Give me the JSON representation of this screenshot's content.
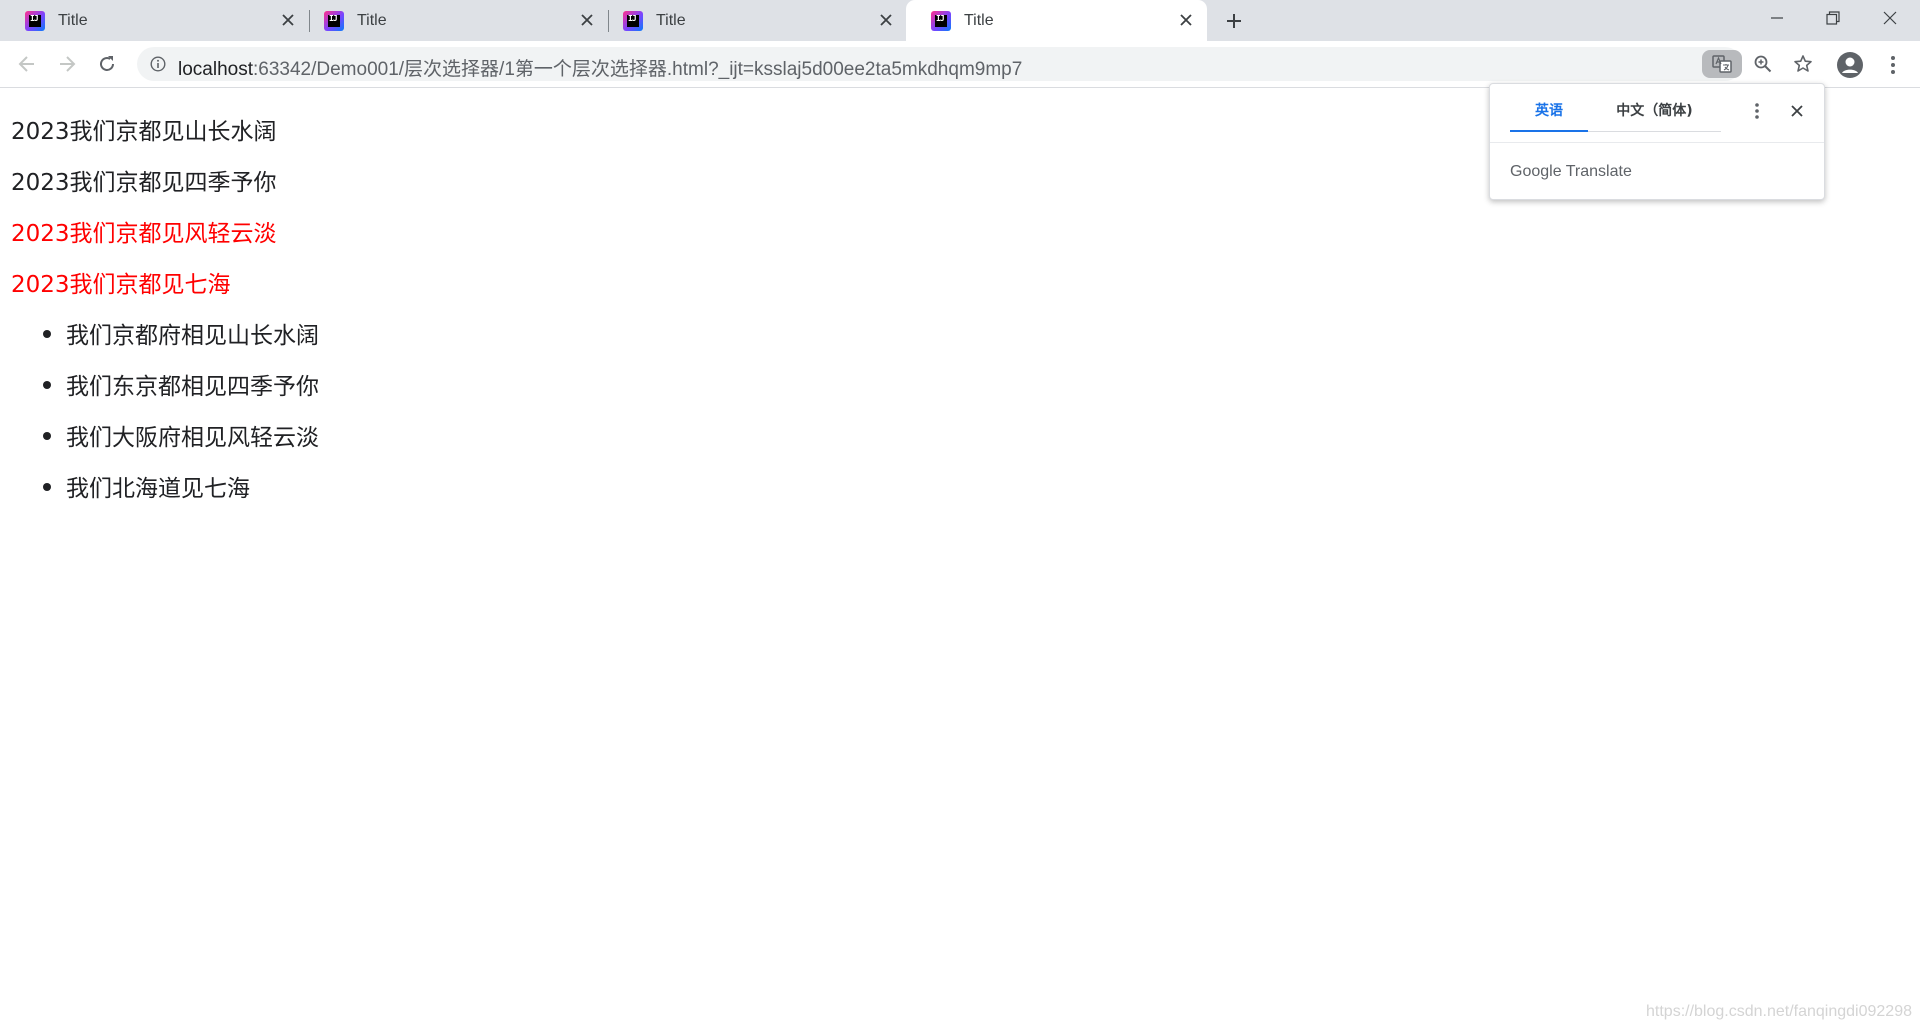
{
  "tabs": [
    {
      "title": "Title",
      "active": false
    },
    {
      "title": "Title",
      "active": false
    },
    {
      "title": "Title",
      "active": false
    },
    {
      "title": "Title",
      "active": true
    }
  ],
  "address_bar": {
    "host": "localhost",
    "path": ":63342/Demo001/层次选择器/1第一个层次选择器.html?_ijt=ksslaj5d00ee2ta5mkdhqm9mp7"
  },
  "page": {
    "paragraphs": [
      {
        "text": "2023我们京都见山长水阔",
        "color": "#202124"
      },
      {
        "text": "2023我们京都见四季予你",
        "color": "#202124"
      },
      {
        "text": "2023我们京都见风轻云淡",
        "color": "#ff0000"
      },
      {
        "text": "2023我们京都见七海",
        "color": "#ff0000"
      }
    ],
    "list_items": [
      "我们京都府相见山长水阔",
      "我们东京都相见四季予你",
      "我们大阪府相见风轻云淡",
      "我们北海道见七海"
    ]
  },
  "translate_bubble": {
    "source_language": "英语",
    "target_language": "中文（简体)",
    "brand": "Google Translate"
  },
  "watermark": "https://blog.csdn.net/fanqingdi092298",
  "colors": {
    "accent": "#1a73e8",
    "highlight_text": "#ff0000"
  }
}
